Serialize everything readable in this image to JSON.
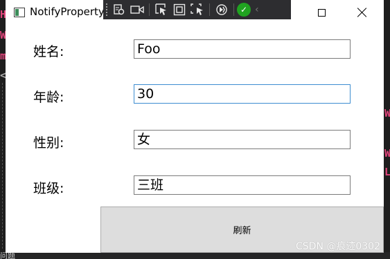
{
  "window": {
    "title": "NotifyPropertyChanged Sample"
  },
  "ide": {
    "left_glyphs": [
      "H",
      "W",
      "m",
      "<"
    ],
    "right_glyphs": [
      "W",
      "W",
      "L"
    ],
    "bottom_text": "问题"
  },
  "debug_toolbar": {
    "icons": [
      "live-visual-tree-icon",
      "video-icon",
      "select-element-icon",
      "display-adorners-icon",
      "track-focus-icon",
      "hot-reload-icon",
      "status-ok-icon",
      "collapse-chevron-icon"
    ]
  },
  "form": {
    "fields": [
      {
        "label": "姓名:",
        "value": "Foo"
      },
      {
        "label": "年龄:",
        "value": "30"
      },
      {
        "label": "性别:",
        "value": "女"
      },
      {
        "label": "班级:",
        "value": "三班"
      }
    ]
  },
  "refresh_button": {
    "label": "刷新"
  },
  "watermark": "CSDN @痕迹0302",
  "colors": {
    "focus_border": "#3c8cd0",
    "button_bg": "#dddddd",
    "toolbar_bg": "#2d2d30",
    "ok_green": "#20a320",
    "ide_accent": "#e0457b"
  }
}
